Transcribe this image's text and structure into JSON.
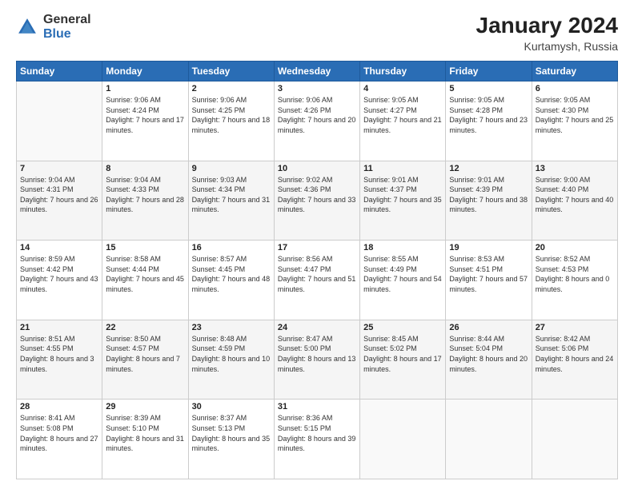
{
  "logo": {
    "general": "General",
    "blue": "Blue"
  },
  "header": {
    "title": "January 2024",
    "subtitle": "Kurtamysh, Russia"
  },
  "days_of_week": [
    "Sunday",
    "Monday",
    "Tuesday",
    "Wednesday",
    "Thursday",
    "Friday",
    "Saturday"
  ],
  "weeks": [
    [
      {
        "day": "",
        "sunrise": "",
        "sunset": "",
        "daylight": ""
      },
      {
        "day": "1",
        "sunrise": "Sunrise: 9:06 AM",
        "sunset": "Sunset: 4:24 PM",
        "daylight": "Daylight: 7 hours and 17 minutes."
      },
      {
        "day": "2",
        "sunrise": "Sunrise: 9:06 AM",
        "sunset": "Sunset: 4:25 PM",
        "daylight": "Daylight: 7 hours and 18 minutes."
      },
      {
        "day": "3",
        "sunrise": "Sunrise: 9:06 AM",
        "sunset": "Sunset: 4:26 PM",
        "daylight": "Daylight: 7 hours and 20 minutes."
      },
      {
        "day": "4",
        "sunrise": "Sunrise: 9:05 AM",
        "sunset": "Sunset: 4:27 PM",
        "daylight": "Daylight: 7 hours and 21 minutes."
      },
      {
        "day": "5",
        "sunrise": "Sunrise: 9:05 AM",
        "sunset": "Sunset: 4:28 PM",
        "daylight": "Daylight: 7 hours and 23 minutes."
      },
      {
        "day": "6",
        "sunrise": "Sunrise: 9:05 AM",
        "sunset": "Sunset: 4:30 PM",
        "daylight": "Daylight: 7 hours and 25 minutes."
      }
    ],
    [
      {
        "day": "7",
        "sunrise": "Sunrise: 9:04 AM",
        "sunset": "Sunset: 4:31 PM",
        "daylight": "Daylight: 7 hours and 26 minutes."
      },
      {
        "day": "8",
        "sunrise": "Sunrise: 9:04 AM",
        "sunset": "Sunset: 4:33 PM",
        "daylight": "Daylight: 7 hours and 28 minutes."
      },
      {
        "day": "9",
        "sunrise": "Sunrise: 9:03 AM",
        "sunset": "Sunset: 4:34 PM",
        "daylight": "Daylight: 7 hours and 31 minutes."
      },
      {
        "day": "10",
        "sunrise": "Sunrise: 9:02 AM",
        "sunset": "Sunset: 4:36 PM",
        "daylight": "Daylight: 7 hours and 33 minutes."
      },
      {
        "day": "11",
        "sunrise": "Sunrise: 9:01 AM",
        "sunset": "Sunset: 4:37 PM",
        "daylight": "Daylight: 7 hours and 35 minutes."
      },
      {
        "day": "12",
        "sunrise": "Sunrise: 9:01 AM",
        "sunset": "Sunset: 4:39 PM",
        "daylight": "Daylight: 7 hours and 38 minutes."
      },
      {
        "day": "13",
        "sunrise": "Sunrise: 9:00 AM",
        "sunset": "Sunset: 4:40 PM",
        "daylight": "Daylight: 7 hours and 40 minutes."
      }
    ],
    [
      {
        "day": "14",
        "sunrise": "Sunrise: 8:59 AM",
        "sunset": "Sunset: 4:42 PM",
        "daylight": "Daylight: 7 hours and 43 minutes."
      },
      {
        "day": "15",
        "sunrise": "Sunrise: 8:58 AM",
        "sunset": "Sunset: 4:44 PM",
        "daylight": "Daylight: 7 hours and 45 minutes."
      },
      {
        "day": "16",
        "sunrise": "Sunrise: 8:57 AM",
        "sunset": "Sunset: 4:45 PM",
        "daylight": "Daylight: 7 hours and 48 minutes."
      },
      {
        "day": "17",
        "sunrise": "Sunrise: 8:56 AM",
        "sunset": "Sunset: 4:47 PM",
        "daylight": "Daylight: 7 hours and 51 minutes."
      },
      {
        "day": "18",
        "sunrise": "Sunrise: 8:55 AM",
        "sunset": "Sunset: 4:49 PM",
        "daylight": "Daylight: 7 hours and 54 minutes."
      },
      {
        "day": "19",
        "sunrise": "Sunrise: 8:53 AM",
        "sunset": "Sunset: 4:51 PM",
        "daylight": "Daylight: 7 hours and 57 minutes."
      },
      {
        "day": "20",
        "sunrise": "Sunrise: 8:52 AM",
        "sunset": "Sunset: 4:53 PM",
        "daylight": "Daylight: 8 hours and 0 minutes."
      }
    ],
    [
      {
        "day": "21",
        "sunrise": "Sunrise: 8:51 AM",
        "sunset": "Sunset: 4:55 PM",
        "daylight": "Daylight: 8 hours and 3 minutes."
      },
      {
        "day": "22",
        "sunrise": "Sunrise: 8:50 AM",
        "sunset": "Sunset: 4:57 PM",
        "daylight": "Daylight: 8 hours and 7 minutes."
      },
      {
        "day": "23",
        "sunrise": "Sunrise: 8:48 AM",
        "sunset": "Sunset: 4:59 PM",
        "daylight": "Daylight: 8 hours and 10 minutes."
      },
      {
        "day": "24",
        "sunrise": "Sunrise: 8:47 AM",
        "sunset": "Sunset: 5:00 PM",
        "daylight": "Daylight: 8 hours and 13 minutes."
      },
      {
        "day": "25",
        "sunrise": "Sunrise: 8:45 AM",
        "sunset": "Sunset: 5:02 PM",
        "daylight": "Daylight: 8 hours and 17 minutes."
      },
      {
        "day": "26",
        "sunrise": "Sunrise: 8:44 AM",
        "sunset": "Sunset: 5:04 PM",
        "daylight": "Daylight: 8 hours and 20 minutes."
      },
      {
        "day": "27",
        "sunrise": "Sunrise: 8:42 AM",
        "sunset": "Sunset: 5:06 PM",
        "daylight": "Daylight: 8 hours and 24 minutes."
      }
    ],
    [
      {
        "day": "28",
        "sunrise": "Sunrise: 8:41 AM",
        "sunset": "Sunset: 5:08 PM",
        "daylight": "Daylight: 8 hours and 27 minutes."
      },
      {
        "day": "29",
        "sunrise": "Sunrise: 8:39 AM",
        "sunset": "Sunset: 5:10 PM",
        "daylight": "Daylight: 8 hours and 31 minutes."
      },
      {
        "day": "30",
        "sunrise": "Sunrise: 8:37 AM",
        "sunset": "Sunset: 5:13 PM",
        "daylight": "Daylight: 8 hours and 35 minutes."
      },
      {
        "day": "31",
        "sunrise": "Sunrise: 8:36 AM",
        "sunset": "Sunset: 5:15 PM",
        "daylight": "Daylight: 8 hours and 39 minutes."
      },
      {
        "day": "",
        "sunrise": "",
        "sunset": "",
        "daylight": ""
      },
      {
        "day": "",
        "sunrise": "",
        "sunset": "",
        "daylight": ""
      },
      {
        "day": "",
        "sunrise": "",
        "sunset": "",
        "daylight": ""
      }
    ]
  ]
}
